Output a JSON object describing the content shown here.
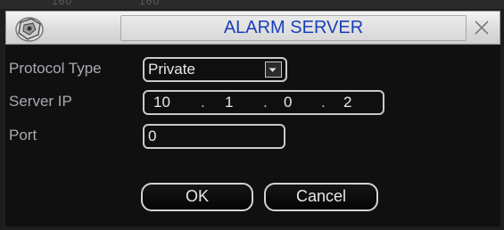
{
  "dialog": {
    "title": "ALARM SERVER",
    "bleed_text": [
      "160",
      "160"
    ]
  },
  "form": {
    "protocol_type": {
      "label": "Protocol Type",
      "value": "Private"
    },
    "server_ip": {
      "label": "Server IP",
      "octets": [
        "10",
        "1",
        "0",
        "2"
      ],
      "separator": "."
    },
    "port": {
      "label": "Port",
      "value": "0"
    }
  },
  "buttons": {
    "ok_label": "OK",
    "cancel_label": "Cancel"
  },
  "colors": {
    "title": "#1a3fb8",
    "label": "#a9a9b3",
    "value": "#e8e8e8",
    "border": "#c9c9c9"
  },
  "icons": {
    "logo": "device-logo-icon",
    "close": "close-icon",
    "dropdown": "chevron-down-icon"
  }
}
